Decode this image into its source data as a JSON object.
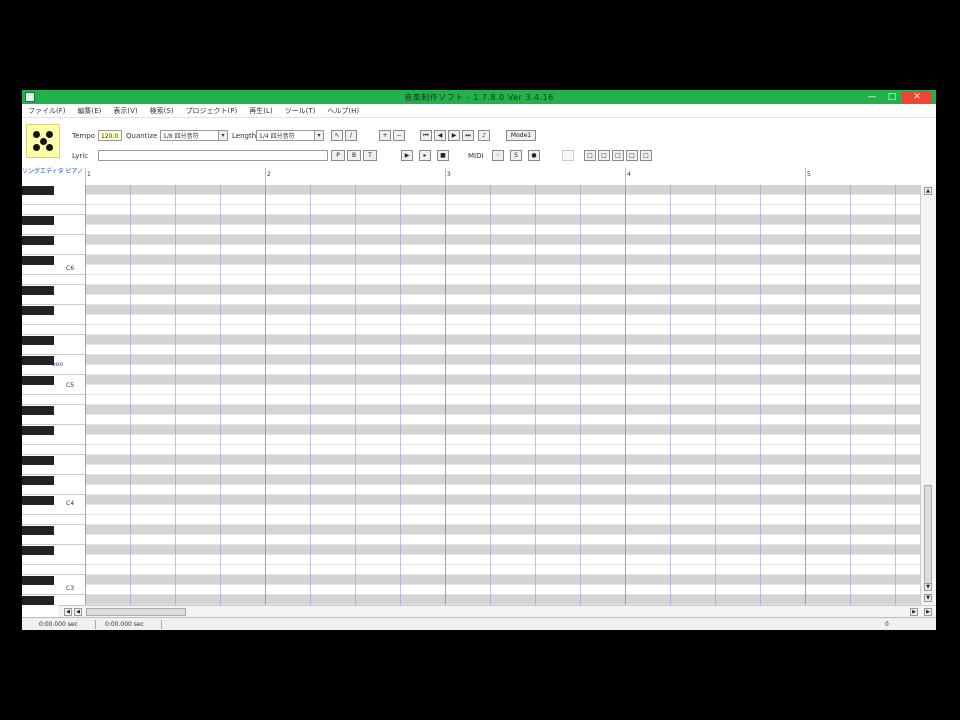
{
  "window": {
    "title": "音楽制作ソフト - 1.7.8.0 Ver 3.4.16",
    "minimize": "—",
    "maximize": "□",
    "close": "✕"
  },
  "menu": [
    "ファイル(F)",
    "編集(E)",
    "表示(V)",
    "検索(S)",
    "プロジェクト(P)",
    "再生(L)",
    "ツール(T)",
    "ヘルプ(H)"
  ],
  "toolbar": {
    "tempo_label": "Tempo",
    "tempo_value": "120.0",
    "quantize_label": "Quantize",
    "quantize_value": "1/8 四分音符",
    "length_label": "Length",
    "length_value": "1/4 四分音符",
    "lyric_label": "Lyric",
    "lyric_value": "",
    "mode_label": "Mode1",
    "midi_label": "MIDI",
    "arrow_symbol": "▾"
  },
  "ruler": {
    "corner_label": "ソングエディタ ピアノ",
    "measures": [
      "1",
      "2",
      "3",
      "4",
      "5"
    ]
  },
  "keyboard": {
    "octave_labels": [
      "C6",
      "C5",
      "C4",
      "C3"
    ],
    "playing_marker": "ooo"
  },
  "statusbar": {
    "field1": "0:00.000 sec",
    "field2": "0:00.000 sec",
    "field3": "0"
  },
  "colors": {
    "titlebar": "#22b14c",
    "measure_line": "#d070b0",
    "beat_line": "#9090d8",
    "black_key_row": "#d4d4d4",
    "white_key_row": "#ffffff"
  }
}
